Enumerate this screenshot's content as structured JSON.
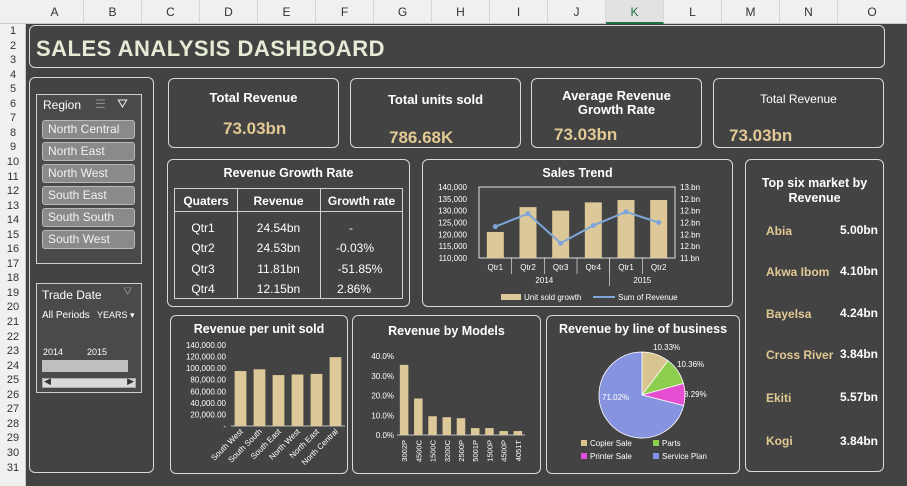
{
  "sheet": {
    "columns": [
      "A",
      "B",
      "C",
      "D",
      "E",
      "F",
      "G",
      "H",
      "I",
      "J",
      "K",
      "L",
      "M",
      "N",
      "O"
    ],
    "selected_column": "K",
    "rows": [
      "1",
      "2",
      "3",
      "4",
      "5",
      "6",
      "7",
      "8",
      "9",
      "10",
      "11",
      "12",
      "13",
      "14",
      "15",
      "16",
      "17",
      "18",
      "19",
      "20",
      "21",
      "22",
      "23",
      "24",
      "25",
      "26",
      "27",
      "28",
      "29",
      "30",
      "31"
    ]
  },
  "dashboard": {
    "title": "SALES ANALYSIS DASHBOARD"
  },
  "kpis": [
    {
      "title": "Total Revenue",
      "value": "73.03bn"
    },
    {
      "title": "Total  units sold",
      "value": "786.68K"
    },
    {
      "title": "Average Revenue Growth Rate",
      "value": "73.03bn"
    },
    {
      "title": "Total Revenue",
      "value": "73.03bn"
    }
  ],
  "region_slicer": {
    "title": "Region",
    "items": [
      "North Central",
      "North East",
      "North West",
      "South East",
      "South South",
      "South West"
    ]
  },
  "date_slicer": {
    "title": "Trade Date",
    "period": "All Periods",
    "unit": "YEARS",
    "years": [
      "2014",
      "2015"
    ]
  },
  "growth_table": {
    "title": "Revenue Growth Rate",
    "headers": [
      "Quaters",
      "Revenue",
      "Growth rate"
    ],
    "rows": [
      [
        "Qtr1",
        "24.54bn",
        "-"
      ],
      [
        "Qtr2",
        "24.53bn",
        "-0.03%"
      ],
      [
        "Qtr3",
        "11.81bn",
        "-51.85%"
      ],
      [
        "Qtr4",
        "12.15bn",
        "2.86%"
      ]
    ]
  },
  "top_markets": {
    "title": "Top six market by Revenue",
    "items": [
      {
        "name": "Abia",
        "value": "5.00bn"
      },
      {
        "name": "Akwa Ibom",
        "value": "4.10bn"
      },
      {
        "name": "Bayelsa",
        "value": "4.24bn"
      },
      {
        "name": "Cross River",
        "value": "3.84bn"
      },
      {
        "name": "Ekiti",
        "value": "5.57bn"
      },
      {
        "name": "Kogi",
        "value": "3.84bn"
      }
    ]
  },
  "colors": {
    "bar": "#dcc898",
    "line": "#7ea6d8",
    "accent": "#e2c994",
    "border": "#d9d9d9"
  },
  "chart_data": [
    {
      "type": "bar",
      "title": "Sales Trend",
      "categories": [
        "Qtr1",
        "Qtr2",
        "Qtr3",
        "Qtr4",
        "Qtr1",
        "Qtr2"
      ],
      "groups": [
        "2014",
        "2015"
      ],
      "series": [
        {
          "name": "Unit sold growth",
          "kind": "bar",
          "values": [
            121000,
            131500,
            130000,
            133500,
            134500,
            134500
          ]
        },
        {
          "name": "Sum of Revenue",
          "kind": "line",
          "axis": "right",
          "values": [
            12.33,
            12.55,
            12.05,
            12.35,
            12.58,
            12.4
          ]
        }
      ],
      "yticks_left": [
        "140,000",
        "135,000",
        "130,000",
        "125,000",
        "120,000",
        "115,000",
        "110,000"
      ],
      "yticks_right": [
        "13.bn",
        "12.bn",
        "12.bn",
        "12.bn",
        "12.bn",
        "12.bn",
        "11.bn"
      ],
      "ylim": [
        110000,
        140000
      ],
      "ylim_right": [
        11.8,
        13.0
      ],
      "legend": "bottom"
    },
    {
      "type": "bar",
      "title": "Revenue per unit sold",
      "categories": [
        "South West",
        "South South",
        "South East",
        "North West",
        "North East",
        "North Central"
      ],
      "values": [
        95000,
        98000,
        88000,
        89000,
        90000,
        119000
      ],
      "yticks": [
        "140,000.00",
        "120,000.00",
        "100,000.00",
        "80,000.00",
        "60,000.00",
        "40,000.00",
        "20,000.00",
        "-"
      ],
      "ylim": [
        0,
        140000
      ]
    },
    {
      "type": "bar",
      "title": "Revenue by Models",
      "categories": [
        "3002P",
        "4500C",
        "1500C",
        "3200C",
        "2500P",
        "5001P",
        "1500P",
        "4500P",
        "4051T"
      ],
      "values": [
        35.5,
        18.5,
        9.5,
        9.0,
        8.5,
        3.5,
        3.5,
        2.0,
        2.0
      ],
      "yticks": [
        "40.0%",
        "30.0%",
        "20.0%",
        "10.0%",
        "0.0%"
      ],
      "ylim": [
        0,
        40
      ]
    },
    {
      "type": "pie",
      "title": "Revenue by line of business",
      "labels": [
        "Copier Sale",
        "Parts",
        "Printer Sale",
        "Service Plan"
      ],
      "values": [
        10.33,
        10.36,
        8.29,
        71.02
      ],
      "data_labels": [
        "10.33%",
        "10.36%",
        "8.29%",
        "71.02%"
      ],
      "colors": [
        "#d8c48e",
        "#8ccf4e",
        "#e64ed2",
        "#8694e0"
      ],
      "legend": "bottom"
    }
  ]
}
